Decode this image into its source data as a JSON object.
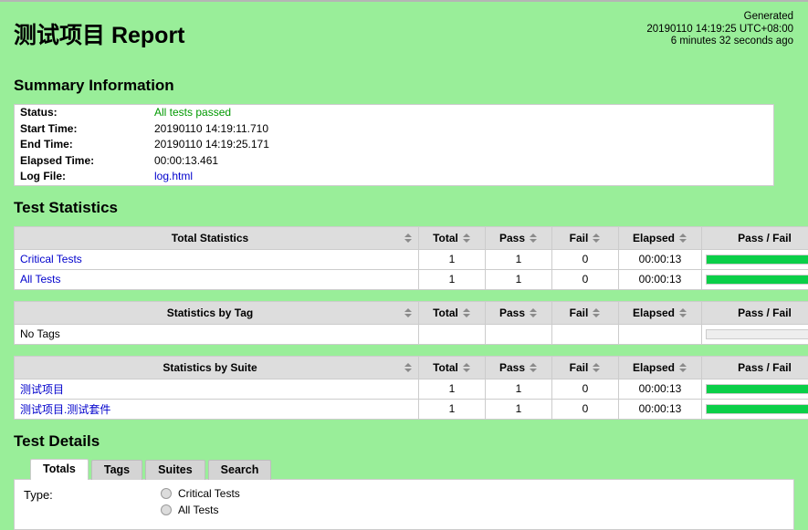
{
  "header": {
    "title": "测试项目 Report",
    "generated_label": "Generated",
    "generated_time": "20190110 14:19:25 UTC+08:00",
    "generated_ago": "6 minutes 32 seconds ago"
  },
  "summary": {
    "section_title": "Summary Information",
    "rows": [
      {
        "label": "Status:",
        "value": "All tests passed",
        "type": "status"
      },
      {
        "label": "Start Time:",
        "value": "20190110 14:19:11.710",
        "type": "text"
      },
      {
        "label": "End Time:",
        "value": "20190110 14:19:25.171",
        "type": "text"
      },
      {
        "label": "Elapsed Time:",
        "value": "00:00:13.461",
        "type": "text"
      },
      {
        "label": "Log File:",
        "value": "log.html",
        "type": "link"
      }
    ]
  },
  "statistics": {
    "section_title": "Test Statistics",
    "columns": {
      "total": "Total",
      "pass": "Pass",
      "fail": "Fail",
      "elapsed": "Elapsed",
      "graph": "Pass / Fail"
    },
    "tables": [
      {
        "name": "total-statistics",
        "title": "Total Statistics",
        "rows": [
          {
            "name": "Critical Tests",
            "is_link": true,
            "total": "1",
            "pass": "1",
            "fail": "0",
            "elapsed": "00:00:13",
            "pass_pct": 100,
            "fail_pct": 0,
            "has_bar": true
          },
          {
            "name": "All Tests",
            "is_link": true,
            "total": "1",
            "pass": "1",
            "fail": "0",
            "elapsed": "00:00:13",
            "pass_pct": 100,
            "fail_pct": 0,
            "has_bar": true
          }
        ]
      },
      {
        "name": "statistics-by-tag",
        "title": "Statistics by Tag",
        "rows": [
          {
            "name": "No Tags",
            "is_link": false,
            "total": "",
            "pass": "",
            "fail": "",
            "elapsed": "",
            "pass_pct": 0,
            "fail_pct": 0,
            "has_bar": true
          }
        ]
      },
      {
        "name": "statistics-by-suite",
        "title": "Statistics by Suite",
        "rows": [
          {
            "name": "测试项目",
            "is_link": true,
            "total": "1",
            "pass": "1",
            "fail": "0",
            "elapsed": "00:00:13",
            "pass_pct": 100,
            "fail_pct": 0,
            "has_bar": true
          },
          {
            "name": "测试项目.测试套件",
            "is_link": true,
            "total": "1",
            "pass": "1",
            "fail": "0",
            "elapsed": "00:00:13",
            "pass_pct": 100,
            "fail_pct": 0,
            "has_bar": true
          }
        ]
      }
    ]
  },
  "details": {
    "section_title": "Test Details",
    "tabs": [
      {
        "label": "Totals",
        "active": true
      },
      {
        "label": "Tags",
        "active": false
      },
      {
        "label": "Suites",
        "active": false
      },
      {
        "label": "Search",
        "active": false
      }
    ],
    "type_label": "Type:",
    "options": [
      {
        "label": "Critical Tests",
        "selected": false
      },
      {
        "label": "All Tests",
        "selected": false
      }
    ]
  },
  "colors": {
    "background": "#99EE99",
    "pass_bar": "#0ACF48",
    "fail_bar": "#E8503A",
    "link": "#0000CC",
    "status_pass_text": "#009900",
    "header_cell": "#DDDDDD"
  }
}
